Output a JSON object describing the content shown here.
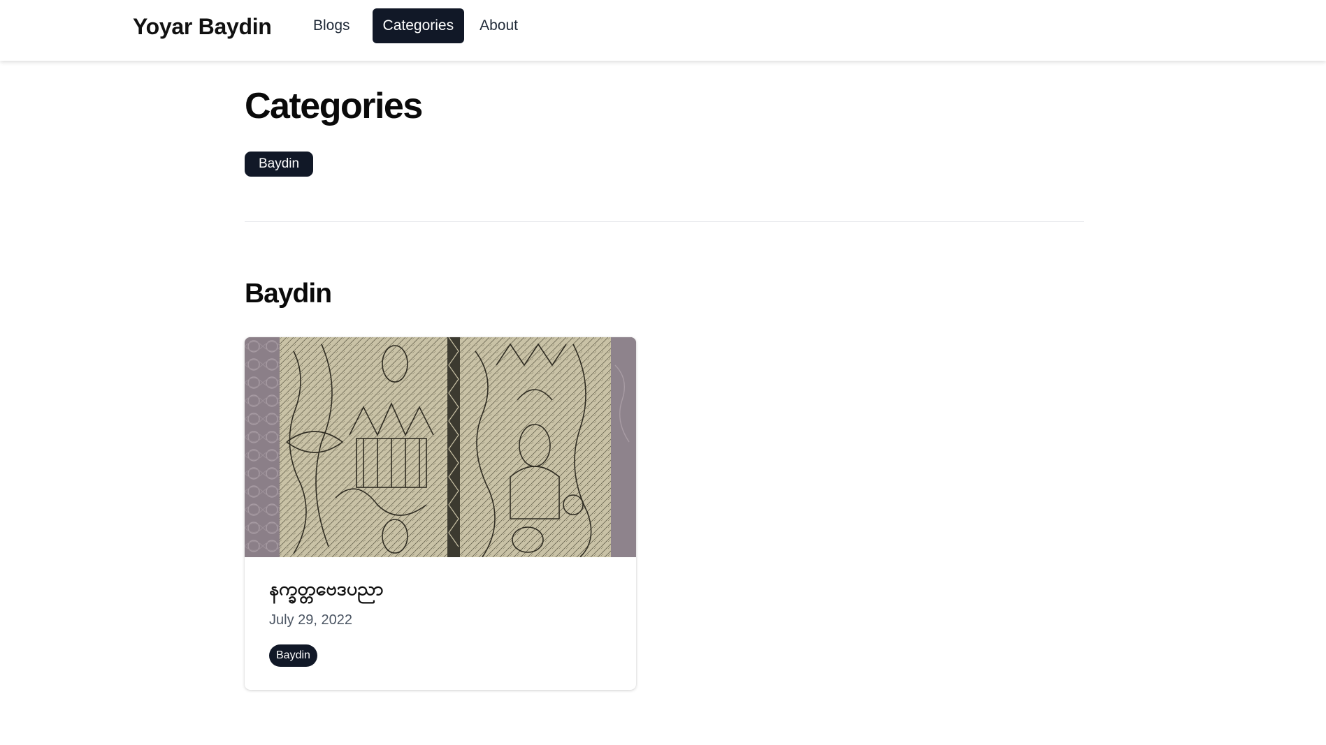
{
  "header": {
    "brand": "Yoyar Baydin",
    "nav": [
      {
        "label": "Blogs",
        "active": false
      },
      {
        "label": "Categories",
        "active": true
      },
      {
        "label": "About",
        "active": false
      }
    ]
  },
  "main": {
    "page_title": "Categories",
    "categories": [
      "Baydin"
    ],
    "sections": [
      {
        "title": "Baydin",
        "posts": [
          {
            "title": "နက္ခတ္တဗေဒပညာ",
            "date": "July 29, 2022",
            "tags": [
              "Baydin"
            ],
            "image": "engraved-manuscript-image"
          }
        ]
      }
    ]
  },
  "colors": {
    "dark": "#111827",
    "text_muted": "#4b5563",
    "divider": "#e5e7eb",
    "background": "#ffffff"
  }
}
